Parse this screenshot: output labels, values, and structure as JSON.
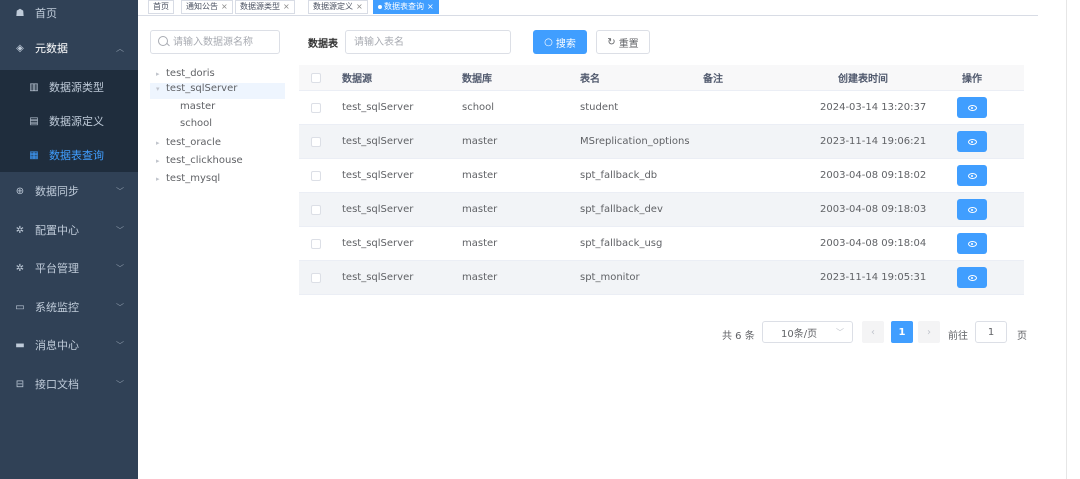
{
  "sidebar": {
    "items": [
      {
        "label": "首页",
        "icon": "dashboard-icon",
        "glyph": "☗"
      },
      {
        "label": "元数据",
        "icon": "layers-icon",
        "glyph": "◈",
        "arrow": "︿"
      },
      {
        "label": "数据源类型",
        "icon": "bar-chart-icon",
        "glyph": "▥"
      },
      {
        "label": "数据源定义",
        "icon": "document-icon",
        "glyph": "▤"
      },
      {
        "label": "数据表查询",
        "icon": "table-icon",
        "glyph": "▦"
      },
      {
        "label": "数据同步",
        "icon": "sync-icon",
        "glyph": "⊕",
        "arrow": "﹀"
      },
      {
        "label": "配置中心",
        "icon": "gear-icon",
        "glyph": "✲",
        "arrow": "﹀"
      },
      {
        "label": "平台管理",
        "icon": "settings-icon",
        "glyph": "✲",
        "arrow": "﹀"
      },
      {
        "label": "系统监控",
        "icon": "monitor-icon",
        "glyph": "▭",
        "arrow": "﹀"
      },
      {
        "label": "消息中心",
        "icon": "message-icon",
        "glyph": "▬",
        "arrow": "﹀"
      },
      {
        "label": "接口文档",
        "icon": "api-doc-icon",
        "glyph": "⊟",
        "arrow": "﹀"
      }
    ]
  },
  "tags": {
    "items": [
      {
        "label": "首页",
        "closable": false
      },
      {
        "label": "通知公告",
        "closable": true
      },
      {
        "label": "数据源类型",
        "closable": true
      },
      {
        "label": "数据源定义",
        "closable": true
      },
      {
        "label": "数据表查询",
        "closable": true
      }
    ],
    "close_glyph": "×"
  },
  "search": {
    "source_placeholder": "请输入数据源名称",
    "table_label": "数据表",
    "table_placeholder": "请输入表名",
    "search_label": "搜索",
    "reset_label": "重置",
    "search_glyph": "○",
    "reset_glyph": "↻"
  },
  "tree": {
    "nodes": [
      {
        "label": "test_doris",
        "caret": "▸",
        "level": 0
      },
      {
        "label": "test_sqlServer",
        "caret": "▾",
        "level": 0,
        "selected": true
      },
      {
        "label": "master",
        "caret": "",
        "level": 1
      },
      {
        "label": "school",
        "caret": "",
        "level": 1
      },
      {
        "label": "test_oracle",
        "caret": "▸",
        "level": 0
      },
      {
        "label": "test_clickhouse",
        "caret": "▸",
        "level": 0
      },
      {
        "label": "test_mysql",
        "caret": "▸",
        "level": 0
      }
    ]
  },
  "table": {
    "headers": {
      "source": "数据源",
      "database": "数据库",
      "table_name": "表名",
      "remark": "备注",
      "created": "创建表时间",
      "action": "操作"
    },
    "rows": [
      {
        "source": "test_sqlServer",
        "database": "school",
        "table_name": "student",
        "remark": "",
        "created": "2024-03-14 13:20:37"
      },
      {
        "source": "test_sqlServer",
        "database": "master",
        "table_name": "MSreplication_options",
        "remark": "",
        "created": "2023-11-14 19:06:21"
      },
      {
        "source": "test_sqlServer",
        "database": "master",
        "table_name": "spt_fallback_db",
        "remark": "",
        "created": "2003-04-08 09:18:02"
      },
      {
        "source": "test_sqlServer",
        "database": "master",
        "table_name": "spt_fallback_dev",
        "remark": "",
        "created": "2003-04-08 09:18:03"
      },
      {
        "source": "test_sqlServer",
        "database": "master",
        "table_name": "spt_fallback_usg",
        "remark": "",
        "created": "2003-04-08 09:18:04"
      },
      {
        "source": "test_sqlServer",
        "database": "master",
        "table_name": "spt_monitor",
        "remark": "",
        "created": "2023-11-14 19:05:31"
      }
    ]
  },
  "pagination": {
    "total": "共 6 条",
    "page_size": "10条/页",
    "size_arrow": "﹀",
    "prev": "‹",
    "current": "1",
    "next": "›",
    "goto_label": "前往",
    "goto_value": "1",
    "page_unit": "页"
  },
  "colors": {
    "accent": "#409eff",
    "sidebar_bg": "#304156",
    "submenu_bg": "#1f2d3d"
  }
}
